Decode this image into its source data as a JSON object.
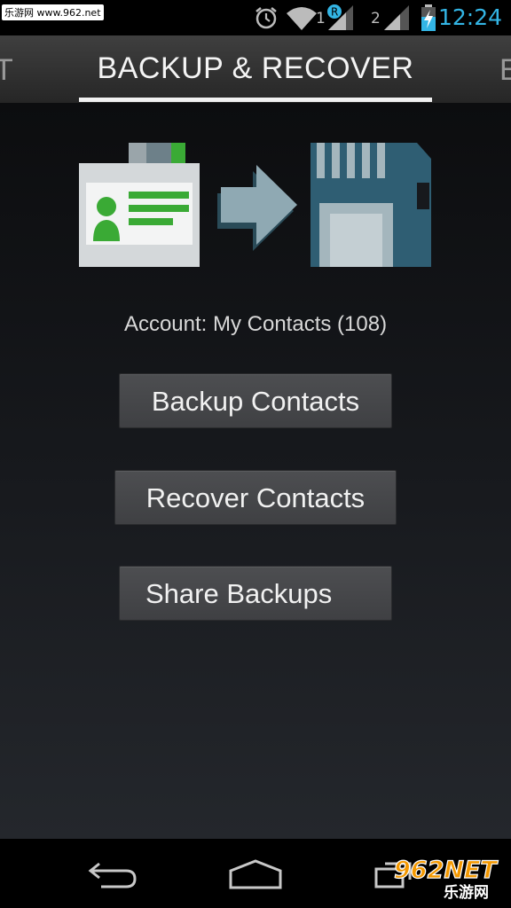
{
  "status_bar": {
    "watermark": "乐游网 www.962.net",
    "sim1_label": "1",
    "sim2_label": "2",
    "time": "12:24",
    "icons": [
      "notification-icon",
      "alarm-icon",
      "wifi-icon",
      "roaming-badge-icon",
      "signal-sim1-icon",
      "signal-sim2-icon",
      "battery-charging-icon"
    ]
  },
  "tabs": {
    "prev_partial": "T",
    "active": "BACKUP & RECOVER",
    "next_partial": "E"
  },
  "main": {
    "account_text": "Account: My Contacts (108)",
    "buttons": {
      "backup": "Backup Contacts",
      "recover": "Recover Contacts",
      "share": "Share Backups"
    },
    "hero_icons": [
      "contact-card-icon",
      "arrow-right-icon",
      "sd-card-icon"
    ]
  },
  "nav_bar": {
    "icons": [
      "back-icon",
      "home-icon",
      "recent-apps-icon"
    ],
    "watermark_text_top": "962NET",
    "watermark_text_bottom": "乐游网"
  },
  "colors": {
    "clock": "#33b5e5",
    "card_green": "#3aaa35",
    "sd_card": "#2f5e73",
    "arrow": "#8fa9b3"
  }
}
